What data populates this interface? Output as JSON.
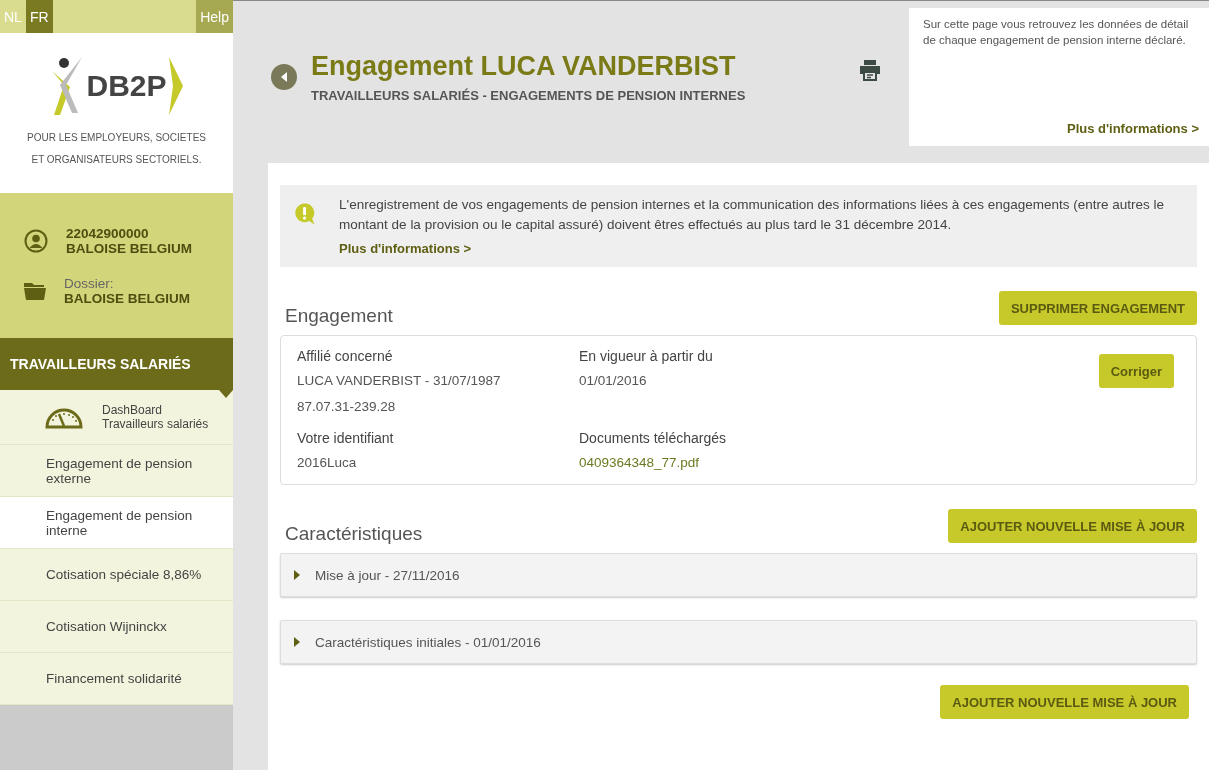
{
  "languages": [
    {
      "label": "NL",
      "selected": false
    },
    {
      "label": "FR",
      "selected": true
    }
  ],
  "help": "Help",
  "logo": {
    "text": "DB2P",
    "tagline": "POUR LES EMPLOYEURS, SOCIETES ET ORGANISATEURS SECTORIELS."
  },
  "account": {
    "number": "22042900000",
    "name": "BALOISE BELGIUM"
  },
  "dossier": {
    "label": "Dossier:",
    "name": "BALOISE BELGIUM"
  },
  "section": "TRAVAILLEURS SALARIÉS",
  "nav": [
    {
      "kind": "dashboard",
      "label": "DashBoard",
      "sublabel": "Travailleurs salariés",
      "selected": false
    },
    {
      "kind": "item",
      "label": "Engagement de pension externe",
      "selected": false
    },
    {
      "kind": "item",
      "label": "Engagement de pension interne",
      "selected": true
    },
    {
      "kind": "item",
      "label": "Cotisation spéciale 8,86%",
      "selected": false
    },
    {
      "kind": "item",
      "label": "Cotisation Wijninckx",
      "selected": false
    },
    {
      "kind": "item",
      "label": "Financement solidarité",
      "selected": false
    }
  ],
  "header": {
    "title": "Engagement LUCA VANDERBIST",
    "subtitle": "TRAVAILLEURS SALARIÉS - ENGAGEMENTS DE PENSION INTERNES"
  },
  "info": {
    "text": "Sur cette page vous retrouvez les données de détail de chaque engagement de pension interne déclaré.",
    "link": "Plus d'informations >"
  },
  "notice": {
    "text": "L'enregistrement de vos engagements de pension internes et la communication des informations liées à ces engagements (entre autres le montant de la provision ou le capital assuré) doivent êtres effectués au plus tard le 31 décembre 2014.",
    "link": "Plus d'informations >"
  },
  "engagement": {
    "title": "Engagement",
    "delete_button": "SUPPRIMER ENGAGEMENT",
    "correct_button": "Corriger",
    "fields": [
      {
        "kind": "text",
        "label": "Affilié concerné",
        "values": [
          "LUCA VANDERBIST - 31/07/1987",
          "87.07.31-239.28"
        ]
      },
      {
        "kind": "text",
        "label": "En vigueur à partir du",
        "values": [
          "01/01/2016"
        ]
      },
      {
        "kind": "text",
        "label": "Votre identifiant",
        "values": [
          "2016Luca"
        ]
      },
      {
        "kind": "link",
        "label": "Documents téléchargés",
        "values": [
          "0409364348_77.pdf"
        ]
      }
    ]
  },
  "characteristics": {
    "title": "Caractéristiques",
    "add_button": "AJOUTER NOUVELLE MISE À JOUR",
    "items": [
      {
        "label": "Mise à jour - 27/11/2016",
        "expanded": false
      },
      {
        "label": "Caractéristiques initiales - 01/01/2016",
        "expanded": false
      }
    ],
    "bottom_button": "AJOUTER NOUVELLE MISE À JOUR"
  }
}
